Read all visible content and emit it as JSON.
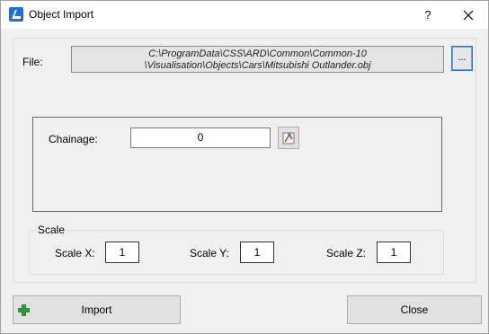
{
  "window": {
    "title": "Object Import",
    "help_label": "?",
    "app_icon": "bricscad-app-icon",
    "close_icon": "close-icon"
  },
  "file": {
    "label": "File:",
    "path_line1": "C:\\ProgramData\\CSS\\ARD\\Common\\Common-10",
    "path_line2": "\\Visualisation\\Objects\\Cars\\Mitsubishi Outlander.obj",
    "browse_label": "..."
  },
  "chainage": {
    "label": "Chainage:",
    "value": "0",
    "pick_icon": "pick-point-icon"
  },
  "scale": {
    "group_title": "Scale",
    "x_label": "Scale X:",
    "x_value": "1",
    "y_label": "Scale Y:",
    "y_value": "1",
    "z_label": "Scale Z:",
    "z_value": "1"
  },
  "buttons": {
    "import_label": "Import",
    "import_icon": "plus-icon",
    "close_label": "Close"
  },
  "colors": {
    "plus_green": "#2e9a3a",
    "browse_border": "#2a73d0",
    "app_icon_blue": "#1f6fcf"
  }
}
